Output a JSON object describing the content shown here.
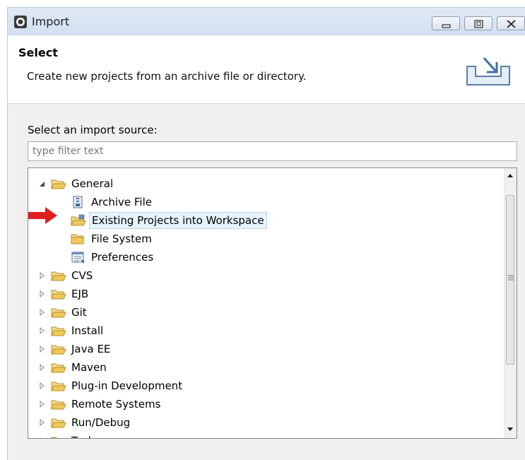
{
  "window": {
    "title": "Import",
    "buttons": [
      "minimize",
      "maximize",
      "close"
    ]
  },
  "header": {
    "title": "Select",
    "description": "Create new projects from an archive file or directory."
  },
  "source": {
    "label": "Select an import source:",
    "filter_placeholder": "type filter text"
  },
  "tree": {
    "items": [
      {
        "label": "General",
        "level": 0,
        "expanded": true,
        "icon": "folder-open-icon"
      },
      {
        "label": "Archive File",
        "level": 1,
        "icon": "archive-file-icon"
      },
      {
        "label": "Existing Projects into Workspace",
        "level": 1,
        "icon": "existing-projects-icon",
        "selected": true
      },
      {
        "label": "File System",
        "level": 1,
        "icon": "folder-icon"
      },
      {
        "label": "Preferences",
        "level": 1,
        "icon": "preferences-icon"
      },
      {
        "label": "CVS",
        "level": 0,
        "expanded": false,
        "icon": "folder-open-icon"
      },
      {
        "label": "EJB",
        "level": 0,
        "expanded": false,
        "icon": "folder-open-icon"
      },
      {
        "label": "Git",
        "level": 0,
        "expanded": false,
        "icon": "folder-open-icon"
      },
      {
        "label": "Install",
        "level": 0,
        "expanded": false,
        "icon": "folder-open-icon"
      },
      {
        "label": "Java EE",
        "level": 0,
        "expanded": false,
        "icon": "folder-open-icon"
      },
      {
        "label": "Maven",
        "level": 0,
        "expanded": false,
        "icon": "folder-open-icon"
      },
      {
        "label": "Plug-in Development",
        "level": 0,
        "expanded": false,
        "icon": "folder-open-icon"
      },
      {
        "label": "Remote Systems",
        "level": 0,
        "expanded": false,
        "icon": "folder-open-icon"
      },
      {
        "label": "Run/Debug",
        "level": 0,
        "expanded": false,
        "icon": "folder-open-icon"
      },
      {
        "label": "Tasks",
        "level": 0,
        "expanded": false,
        "icon": "folder-open-icon"
      }
    ]
  },
  "colors": {
    "pointer_arrow": "#e02020",
    "folder": "#e8c15a",
    "selection": "#e5f3fb"
  }
}
